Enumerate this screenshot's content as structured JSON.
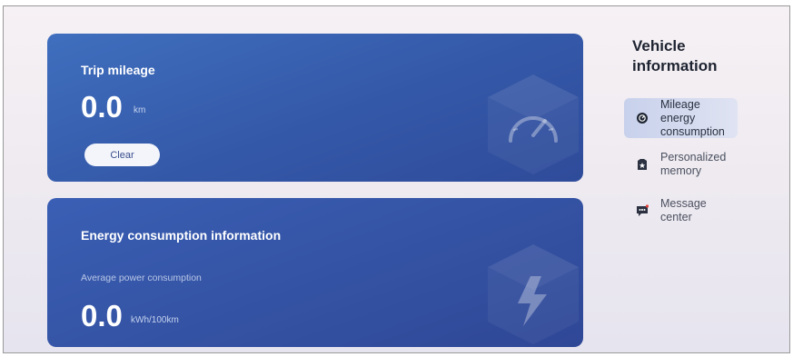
{
  "trip": {
    "title": "Trip mileage",
    "value": "0.0",
    "unit": "km",
    "clear_label": "Clear"
  },
  "energy": {
    "title": "Energy consumption information",
    "sub_label": "Average power consumption",
    "value": "0.0",
    "unit": "kWh/100km"
  },
  "sidebar": {
    "title": "Vehicle information",
    "items": [
      {
        "label": "Mileage energy consumption",
        "icon": "speedometer-icon",
        "active": true
      },
      {
        "label": "Personalized memory",
        "icon": "memory-icon",
        "active": false
      },
      {
        "label": "Message center",
        "icon": "message-icon",
        "active": false
      }
    ]
  },
  "colors": {
    "card_blue": "#3458a8",
    "active_nav": "#c8d1ec",
    "background": "#eeeaf0"
  }
}
